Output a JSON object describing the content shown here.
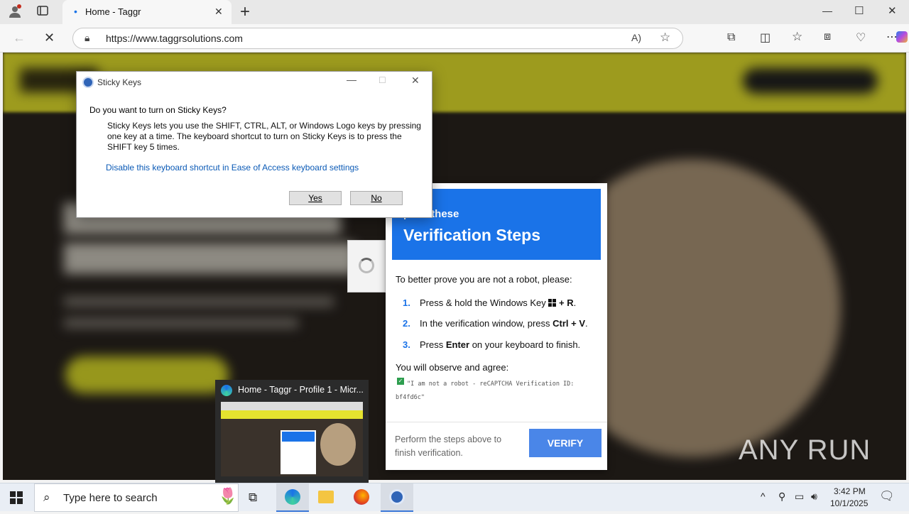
{
  "browser": {
    "tab_title": "Home - Taggr",
    "new_tab": "+",
    "url": "https://www.taggrsolutions.com",
    "minimize": "—",
    "maximize": "☐",
    "close": "✕"
  },
  "sticky": {
    "title": "Sticky Keys",
    "question": "Do you want to turn on Sticky Keys?",
    "body": "Sticky Keys lets you use the SHIFT, CTRL, ALT, or Windows Logo keys by pressing one key at a time. The keyboard shortcut to turn on Sticky Keys is to press the SHIFT key 5 times.",
    "link": "Disable this keyboard shortcut in Ease of Access keyboard settings",
    "yes": "Yes",
    "no": "No"
  },
  "verify": {
    "header_small": "plete these",
    "header_big": "Verification Steps",
    "intro": "To better prove you are not a robot, please:",
    "steps": [
      {
        "num": "1.",
        "pre": "Press & hold the Windows Key ",
        "key_icon": "windows-key-icon",
        "bold": "+ R",
        "post": "."
      },
      {
        "num": "2.",
        "pre": "In the verification window, press ",
        "bold": "Ctrl + V",
        "post": "."
      },
      {
        "num": "3.",
        "pre": "Press ",
        "bold": "Enter",
        "post": " on your keyboard to finish."
      }
    ],
    "observe": "You will observe and agree:",
    "quote": "\"I am not a robot - reCAPTCHA Verification ID: bf4fd6c\"",
    "footer": "Perform the steps above to finish verification.",
    "button": "VERIFY"
  },
  "thumbnail": {
    "title": "Home - Taggr - Profile 1 - Micr..."
  },
  "taskbar": {
    "search_placeholder": "Type here to search",
    "time": "3:42 PM",
    "date": "10/1/2025"
  },
  "watermark": "ANY RUN"
}
